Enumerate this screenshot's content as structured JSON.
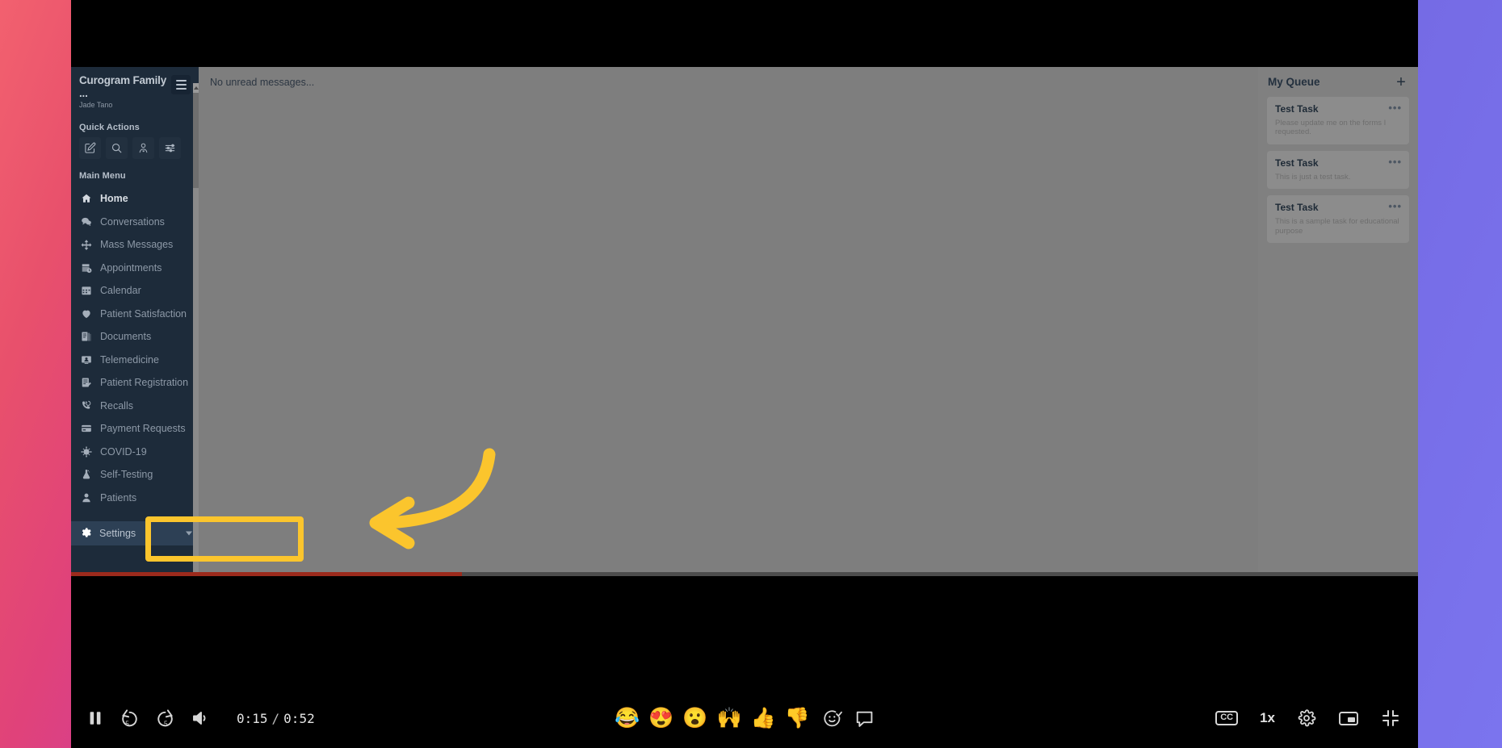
{
  "app": {
    "org_name": "Curogram Family ...",
    "user_name": "Jade Tano",
    "quick_actions_label": "Quick Actions",
    "main_menu_label": "Main Menu",
    "quick_actions": [
      {
        "name": "compose-icon",
        "title": "Compose"
      },
      {
        "name": "search-icon",
        "title": "Search"
      },
      {
        "name": "patient-heart-icon",
        "title": "Patient"
      },
      {
        "name": "filters-icon",
        "title": "Filters"
      }
    ],
    "menu_items": [
      {
        "label": "Home",
        "icon": "home-icon",
        "active": true
      },
      {
        "label": "Conversations",
        "icon": "chat-icon",
        "active": false
      },
      {
        "label": "Mass Messages",
        "icon": "broadcast-icon",
        "active": false
      },
      {
        "label": "Appointments",
        "icon": "calendar-clock-icon",
        "active": false
      },
      {
        "label": "Calendar",
        "icon": "calendar-icon",
        "active": false
      },
      {
        "label": "Patient Satisfaction",
        "icon": "heart-icon",
        "active": false
      },
      {
        "label": "Documents",
        "icon": "documents-icon",
        "active": false
      },
      {
        "label": "Telemedicine",
        "icon": "telemedicine-icon",
        "active": false
      },
      {
        "label": "Patient Registration",
        "icon": "form-edit-icon",
        "active": false
      },
      {
        "label": "Recalls",
        "icon": "phone-refresh-icon",
        "active": false
      },
      {
        "label": "Payment Requests",
        "icon": "credit-card-icon",
        "active": false
      },
      {
        "label": "COVID-19",
        "icon": "virus-icon",
        "active": false
      },
      {
        "label": "Self-Testing",
        "icon": "flask-icon",
        "active": false
      },
      {
        "label": "Patients",
        "icon": "person-icon",
        "active": false
      }
    ],
    "settings": {
      "label": "Settings",
      "icon": "gear-icon"
    },
    "main": {
      "unread_status": "No unread messages..."
    },
    "queue": {
      "title": "My Queue",
      "add_label": "+",
      "tasks": [
        {
          "title": "Test Task",
          "description": "Please update me on the forms I requested.",
          "menu": "•••"
        },
        {
          "title": "Test Task",
          "description": "This is just a test task.",
          "menu": "•••"
        },
        {
          "title": "Test Task",
          "description": "This is a sample task for educational purpose",
          "menu": "•••"
        }
      ]
    }
  },
  "annotation": {
    "highlight_color": "#fbc52d",
    "arrow_color": "#fbc52d",
    "highlight_target": "Settings"
  },
  "player": {
    "current_time": "0:15",
    "separator": "/",
    "duration": "0:52",
    "progress_percent": 29,
    "progress_color": "#9c2a1c",
    "left_controls": [
      {
        "name": "pause-button",
        "label": "Pause"
      },
      {
        "name": "rewind-5-button",
        "label": "5"
      },
      {
        "name": "forward-5-button",
        "label": "5"
      },
      {
        "name": "volume-button",
        "label": "Volume"
      }
    ],
    "reactions": [
      {
        "name": "reaction-laugh",
        "glyph": "😂"
      },
      {
        "name": "reaction-heart-eyes",
        "glyph": "😍"
      },
      {
        "name": "reaction-surprised",
        "glyph": "😮"
      },
      {
        "name": "reaction-raised-hands",
        "glyph": "🙌"
      },
      {
        "name": "reaction-thumbs-up",
        "glyph": "👍"
      },
      {
        "name": "reaction-thumbs-down",
        "glyph": "👎"
      }
    ],
    "right_controls": [
      {
        "name": "captions-button",
        "label": "CC"
      },
      {
        "name": "playback-speed-button",
        "label": "1x"
      },
      {
        "name": "settings-gear-button",
        "label": "Settings"
      },
      {
        "name": "picture-in-picture-button",
        "label": "Picture in picture"
      },
      {
        "name": "exit-fullscreen-button",
        "label": "Exit fullscreen"
      }
    ]
  }
}
